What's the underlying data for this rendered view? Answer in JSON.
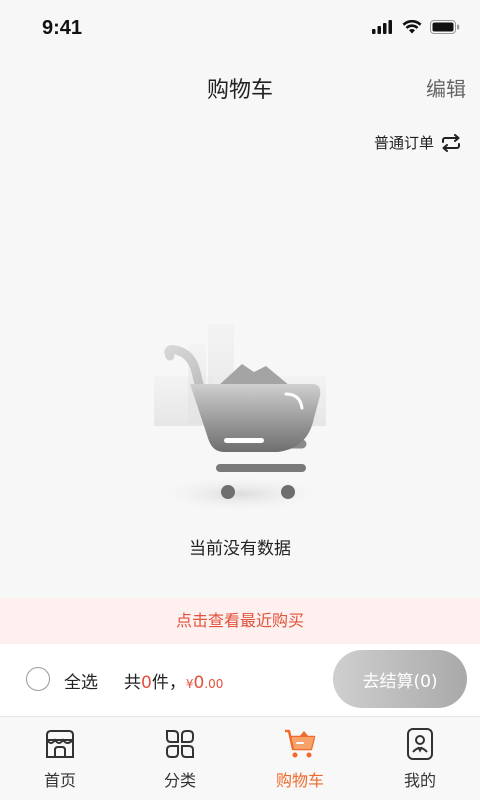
{
  "status_bar": {
    "time": "9:41"
  },
  "nav": {
    "title": "购物车",
    "edit_label": "编辑"
  },
  "order_switch": {
    "label": "普通订单"
  },
  "empty_state": {
    "message": "当前没有数据"
  },
  "recent_banner": {
    "label": "点击查看最近购买"
  },
  "checkout": {
    "select_all_label": "全选",
    "summary_prefix": "共",
    "item_count": "0",
    "summary_unit": "件，",
    "currency": "¥",
    "price_int": "0",
    "price_dec": ".00",
    "button_label": "去结算(0)"
  },
  "tabs": [
    {
      "label": "首页",
      "icon": "storefront-icon",
      "active": false
    },
    {
      "label": "分类",
      "icon": "category-grid-icon",
      "active": false
    },
    {
      "label": "购物车",
      "icon": "cart-icon",
      "active": true
    },
    {
      "label": "我的",
      "icon": "profile-icon",
      "active": false
    }
  ],
  "colors": {
    "accent": "#f06a2c",
    "price_red": "#e2523c",
    "banner_bg": "#fdf0ee"
  }
}
